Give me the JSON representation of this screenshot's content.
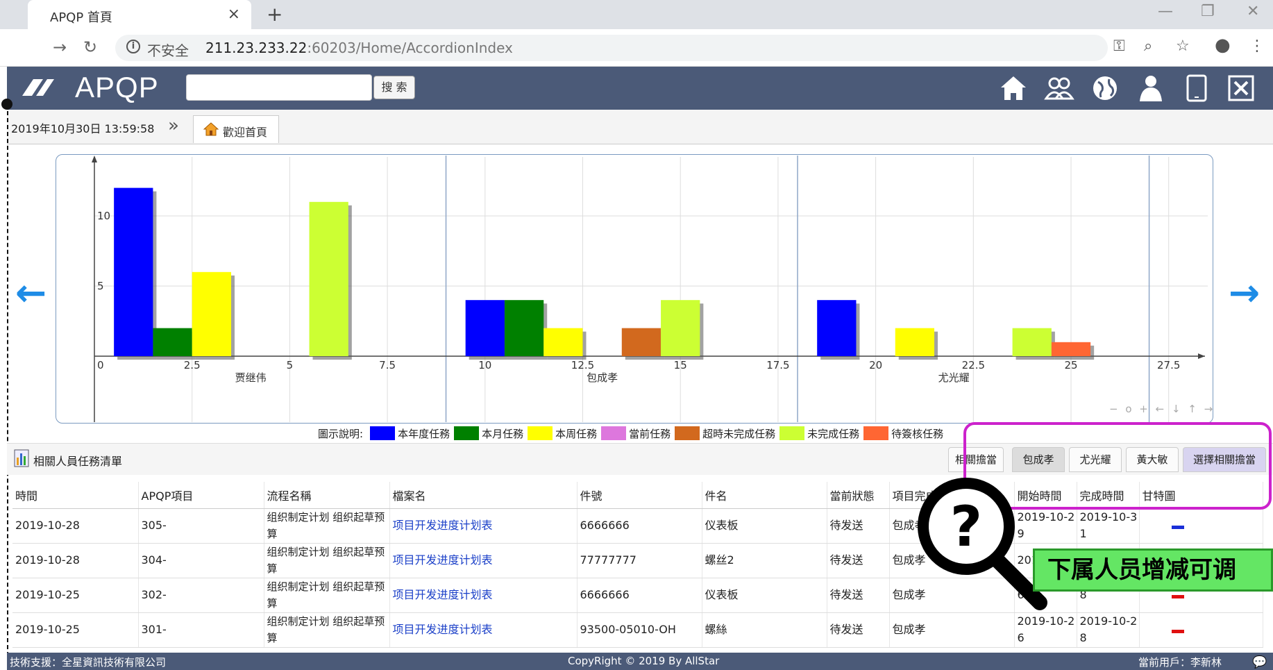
{
  "browser": {
    "tab_title": "APQP 首頁",
    "tab_close": "×",
    "new_tab": "+",
    "win_minimize": "—",
    "win_restore": "❐",
    "win_close": "✕",
    "security_label": "不安全",
    "url_host": "211.23.233.22",
    "url_rest": ":60203/Home/AccordionIndex"
  },
  "header": {
    "logo_text": "APQP",
    "search_placeholder": "",
    "search_button": "搜 索",
    "icons": [
      "home-icon",
      "group-icon",
      "globe-icon",
      "user-icon",
      "tablet-icon",
      "close-box-icon"
    ]
  },
  "datebar": {
    "datetime": "2019年10月30日 13:59:58",
    "expand": "»",
    "welcome_tab": "歡迎首頁"
  },
  "chart_data": {
    "type": "bar",
    "xlim": [
      0,
      28.5
    ],
    "ylim": [
      -1,
      15
    ],
    "x_ticks": [
      "0",
      "2.5",
      "5",
      "7.5",
      "10",
      "12.5",
      "15",
      "17.5",
      "20",
      "22.5",
      "25",
      "27.5"
    ],
    "y_ticks": [
      "0",
      "5",
      "10"
    ],
    "groups": [
      "贾继伟",
      "包成孝",
      "尤光耀"
    ],
    "series": [
      {
        "name": "本年度任務",
        "color": "#0000ff",
        "values": [
          12,
          4,
          4
        ]
      },
      {
        "name": "本月任務",
        "color": "#008000",
        "values": [
          2,
          4,
          0
        ]
      },
      {
        "name": "本周任務",
        "color": "#ffff00",
        "values": [
          6,
          2,
          2
        ]
      },
      {
        "name": "當前任務",
        "color": "#dd77dd",
        "values": [
          0,
          0,
          0
        ]
      },
      {
        "name": "超時未完成任務",
        "color": "#d2691e",
        "values": [
          0,
          2,
          0
        ]
      },
      {
        "name": "未完成任務",
        "color": "#ccff33",
        "values": [
          11,
          4,
          2
        ]
      },
      {
        "name": "待簽核任務",
        "color": "#ff6633",
        "values": [
          0,
          0,
          1
        ]
      }
    ],
    "legend_title": "圖示說明:",
    "legend_position": "bottom",
    "grid": true,
    "zoom_controls": "− o + ← ↓ ↑ →"
  },
  "panel": {
    "title": "相關人員任務清單",
    "person_tabs": [
      "相關擔當",
      "包成孝",
      "尤光耀",
      "黃大敏",
      "選擇相關擔當"
    ]
  },
  "table": {
    "columns": [
      "時間",
      "APQP項目",
      "流程名稱",
      "檔案名",
      "件號",
      "件名",
      "當前狀態",
      "項目完成",
      "開始時間",
      "完成時間",
      "甘特圖"
    ],
    "rows": [
      {
        "time": "2019-10-28",
        "project": "305-",
        "flow": "组织制定计划 组织起草预算",
        "file": "项目开发进度计划表",
        "part_no": "6666666",
        "part_name": "仪表板",
        "status": "待发送",
        "owner": "包成孝",
        "start": "2019-10-29",
        "end": "2019-10-31",
        "gantt_color": "#1a2fd8"
      },
      {
        "time": "2019-10-28",
        "project": "304-",
        "flow": "组织制定计划 组织起草预算",
        "file": "项目开发进度计划表",
        "part_no": "77777777",
        "part_name": "螺丝2",
        "status": "待发送",
        "owner": "包成孝",
        "start": "2019-10-2",
        "end": "",
        "gantt_color": ""
      },
      {
        "time": "2019-10-25",
        "project": "302-",
        "flow": "组织制定计划 组织起草预算",
        "file": "项目开发进度计划表",
        "part_no": "6666666",
        "part_name": "仪表板",
        "status": "待发送",
        "owner": "包成孝",
        "start": "6",
        "end": "8",
        "gantt_color": "#e01010"
      },
      {
        "time": "2019-10-25",
        "project": "301-",
        "flow": "组织制定计划 组织起草预算",
        "file": "项目开发进度计划表",
        "part_no": "93500-05010-OH",
        "part_name": "螺絲",
        "status": "待发送",
        "owner": "包成孝",
        "start": "2019-10-26",
        "end": "2019-10-28",
        "gantt_color": "#e01010"
      }
    ]
  },
  "callout": {
    "text": "下属人员增减可调"
  },
  "footer": {
    "support": "技術支援：全星資訊技術有限公司",
    "copyright": "CopyRight © 2019 By AllStar",
    "current_user": "當前用戶：李新林"
  }
}
